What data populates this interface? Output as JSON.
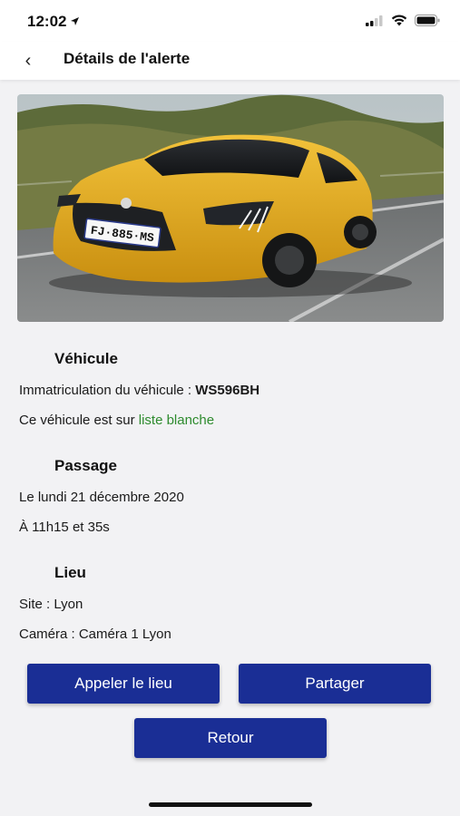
{
  "status": {
    "time": "12:02"
  },
  "nav": {
    "back_glyph": "‹",
    "title": "Détails de l'alerte"
  },
  "vehicle": {
    "section_title": "Véhicule",
    "plate_label": "Immatriculation du véhicule : ",
    "plate_value": "WS596BH",
    "list_text": "Ce véhicule est sur ",
    "list_status": "liste blanche",
    "photo_plate": "FJ·885·MS"
  },
  "passage": {
    "section_title": "Passage",
    "date": "Le lundi 21 décembre 2020",
    "time": "À 11h15 et 35s"
  },
  "lieu": {
    "section_title": "Lieu",
    "site": "Site : Lyon",
    "camera": "Caméra : Caméra 1 Lyon"
  },
  "actions": {
    "call_label": "Appeler le lieu",
    "share_label": "Partager",
    "back_label": "Retour"
  },
  "colors": {
    "button_bg": "#1a2e95",
    "whitelist_text": "#2e8b2e",
    "screen_bg": "#f2f2f4"
  }
}
